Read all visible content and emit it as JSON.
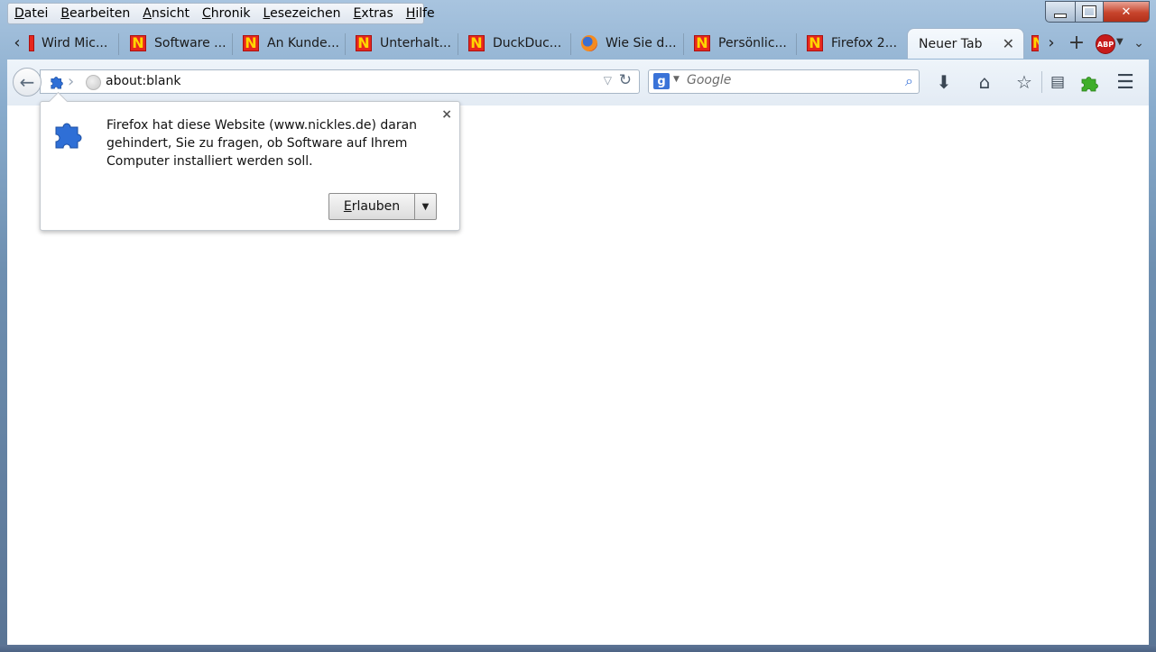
{
  "menu": {
    "items": [
      "Datei",
      "Bearbeiten",
      "Ansicht",
      "Chronik",
      "Lesezeichen",
      "Extras",
      "Hilfe"
    ]
  },
  "tabs": [
    {
      "label": "Wird Mic...",
      "favicon": "nickles-icon"
    },
    {
      "label": "Software ...",
      "favicon": "nickles-icon"
    },
    {
      "label": "An Kunde...",
      "favicon": "nickles-icon"
    },
    {
      "label": "Unterhalt...",
      "favicon": "nickles-icon"
    },
    {
      "label": "DuckDuc...",
      "favicon": "nickles-icon"
    },
    {
      "label": "Wie Sie d...",
      "favicon": "firefox-icon"
    },
    {
      "label": "Persönlic...",
      "favicon": "nickles-icon"
    },
    {
      "label": "Firefox 2...",
      "favicon": "nickles-icon"
    },
    {
      "label": "Neuer Tab",
      "favicon": "none",
      "active": true
    }
  ],
  "navbar": {
    "url": "about:blank",
    "search_placeholder": "Google",
    "abp_label": "ABP"
  },
  "popup": {
    "message": "Firefox hat diese Website (www.nickles.de) daran gehindert, Sie zu fragen, ob Software auf Ihrem Computer installiert werden soll.",
    "allow_label": "Erlauben",
    "close_glyph": "×"
  },
  "colors": {
    "accent": "#3a73d8",
    "close_button": "#c7442c",
    "nickles_red": "#e7271d",
    "nickles_yellow": "#ffd600"
  }
}
